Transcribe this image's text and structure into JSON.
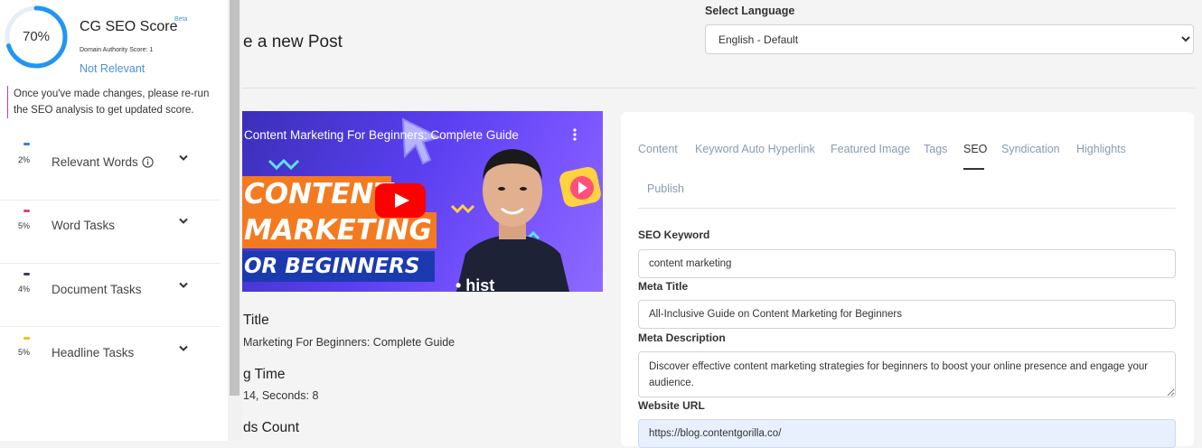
{
  "seo_panel": {
    "score_percent": "70%",
    "score_value": 0.7,
    "title": "CG SEO Score",
    "beta": "Beta",
    "domain_authority": "Domain Authority Score: 1",
    "relevance": "Not Relevant",
    "rerun_note": "Once you've made changes, please re-run the SEO analysis to get updated score.",
    "tasks": [
      {
        "percent": "2%",
        "label": "Relevant Words",
        "color": "#2f7fe0"
      },
      {
        "percent": "5%",
        "label": "Word Tasks",
        "color": "#e0446a"
      },
      {
        "percent": "4%",
        "label": "Document Tasks",
        "color": "#3a3f5c"
      },
      {
        "percent": "5%",
        "label": "Headline Tasks",
        "color": "#f2c21a"
      }
    ],
    "colors": {
      "ring": "#2196f3",
      "accent": "#4a90e2"
    }
  },
  "header": {
    "page_title": "e a new Post",
    "language_label": "Select Language",
    "language_value": "English - Default"
  },
  "video": {
    "title": "Content Marketing For Beginners: Complete Guide",
    "band_1": "CONTENT",
    "band_2": "MARKETING",
    "band_3": "OR BEGINNERS",
    "shirt_text": "• hist"
  },
  "post_fields": {
    "title_label": "Title",
    "title_value": "Marketing For Beginners: Complete Guide",
    "reading_label": "g Time",
    "reading_value": "14, Seconds: 8",
    "words_label": "ds Count"
  },
  "tabs": [
    "Content",
    "Keyword Auto Hyperlink",
    "Featured Image",
    "Tags",
    "SEO",
    "Syndication",
    "Highlights",
    "Publish"
  ],
  "active_tab": "SEO",
  "seo_form": {
    "keyword_label": "SEO Keyword",
    "keyword_value": "content marketing",
    "meta_title_label": "Meta Title",
    "meta_title_value": "All-Inclusive Guide on Content Marketing for Beginners",
    "meta_description_label": "Meta Description",
    "meta_description_value": "Discover effective content marketing strategies for beginners to boost your online presence and engage your audience.",
    "website_url_label": "Website URL",
    "website_url_value": "https://blog.contentgorilla.co/"
  },
  "icons": [
    "score-ring",
    "info-icon",
    "chevron-down-icon",
    "play-button-icon",
    "kebab-menu-icon"
  ]
}
